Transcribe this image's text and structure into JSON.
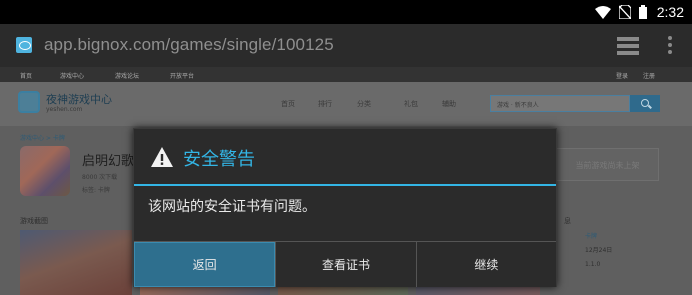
{
  "status_bar": {
    "time": "2:32"
  },
  "browser": {
    "url": "app.bignox.com/games/single/100125"
  },
  "webpage": {
    "topnav": [
      "首页",
      "游戏中心",
      "游戏论坛",
      "开放平台"
    ],
    "topnav_right": [
      "登录",
      "注册"
    ],
    "logo_title": "夜神游戏中心",
    "logo_sub": "yeshen.com",
    "nav": [
      "首页",
      "排行",
      "分类",
      "礼包",
      "辅助"
    ],
    "search_placeholder": "游戏  · 新不良人",
    "breadcrumb": "游戏中心 > 卡牌",
    "game_name": "启明幻歌",
    "game_meta": "8000 次下载",
    "game_tag": "标签:    卡牌",
    "download_box": "当前游戏尚未上架",
    "screens_title": "游戏截图",
    "side_label": "息",
    "side_values": [
      "卡牌",
      "12月24日",
      "1.1.0"
    ]
  },
  "dialog": {
    "title": "安全警告",
    "message": "该网站的安全证书有问题。",
    "buttons": [
      "返回",
      "查看证书",
      "继续"
    ]
  },
  "colors": {
    "accent": "#33b5e5",
    "dialog_bg": "#2b2b2b",
    "highlight_button": "#2e6f8e"
  }
}
